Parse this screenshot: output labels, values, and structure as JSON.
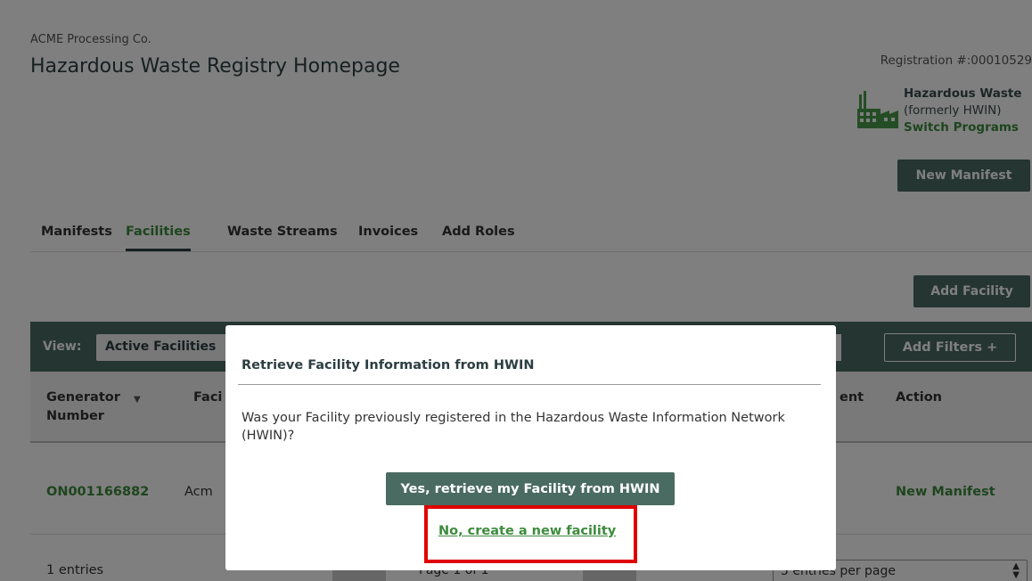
{
  "header": {
    "company": "ACME Processing Co.",
    "title": "Hazardous Waste Registry Homepage",
    "registration": "Registration #:00010529"
  },
  "program": {
    "name": "Hazardous Waste",
    "subtitle": "(formerly HWIN)",
    "switch_label": "Switch Programs",
    "icon": "factory-icon"
  },
  "actions": {
    "new_manifest": "New Manifest",
    "add_facility": "Add Facility"
  },
  "tabs": [
    {
      "label": "Manifests",
      "active": false
    },
    {
      "label": "Facilities",
      "active": true
    },
    {
      "label": "Waste Streams",
      "active": false
    },
    {
      "label": "Invoices",
      "active": false
    },
    {
      "label": "Add Roles",
      "active": false
    }
  ],
  "toolbar": {
    "view_label": "View:",
    "view_value": "Active Facilities",
    "add_filters": "Add Filters +"
  },
  "table": {
    "columns": {
      "generator_line1": "Generator",
      "generator_line2": "Number",
      "facility_fragment": "Faci",
      "ent_fragment": "ent",
      "action": "Action"
    },
    "rows": [
      {
        "generator_number": "ON001166882",
        "facility": "Acm",
        "action": "New Manifest"
      }
    ],
    "footer": {
      "entries": "1 entries",
      "page_info": "Page 1 of 1",
      "per_page": "5 entries per page"
    }
  },
  "modal": {
    "title": "Retrieve Facility Information from HWIN",
    "question": "Was your Facility previously registered in the Hazardous Waste Information Network (HWIN)?",
    "yes_label": "Yes, retrieve my Facility from HWIN",
    "no_label": "No, create a new facility"
  },
  "colors": {
    "primary": "#4a6b62",
    "link_green": "#3d8b3d",
    "highlight_red": "#e00000"
  }
}
